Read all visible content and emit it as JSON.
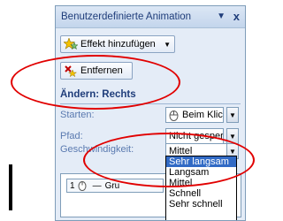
{
  "pane": {
    "title": "Benutzerdefinierte Animation",
    "menu_arrow": "▼",
    "close": "x"
  },
  "toolbar": {
    "add_effect_label": "Effekt hinzufügen",
    "remove_label": "Entfernen"
  },
  "section": {
    "title": "Ändern: Rechts"
  },
  "fields": {
    "start_label": "Starten:",
    "start_value": "Beim Klicken",
    "path_label": "Pfad:",
    "path_value": "Nicht gesperrt",
    "speed_label": "Geschwindigkeit:",
    "speed_value": "Mittel"
  },
  "speed_options": [
    "Sehr langsam",
    "Langsam",
    "Mittel",
    "Schnell",
    "Sehr schnell"
  ],
  "list": {
    "items": [
      {
        "number": "1",
        "dash": "—",
        "text": "Gru"
      }
    ]
  },
  "colors": {
    "highlight": "#316ac5",
    "annotation": "#e10000",
    "header_text": "#1f3d7a"
  }
}
